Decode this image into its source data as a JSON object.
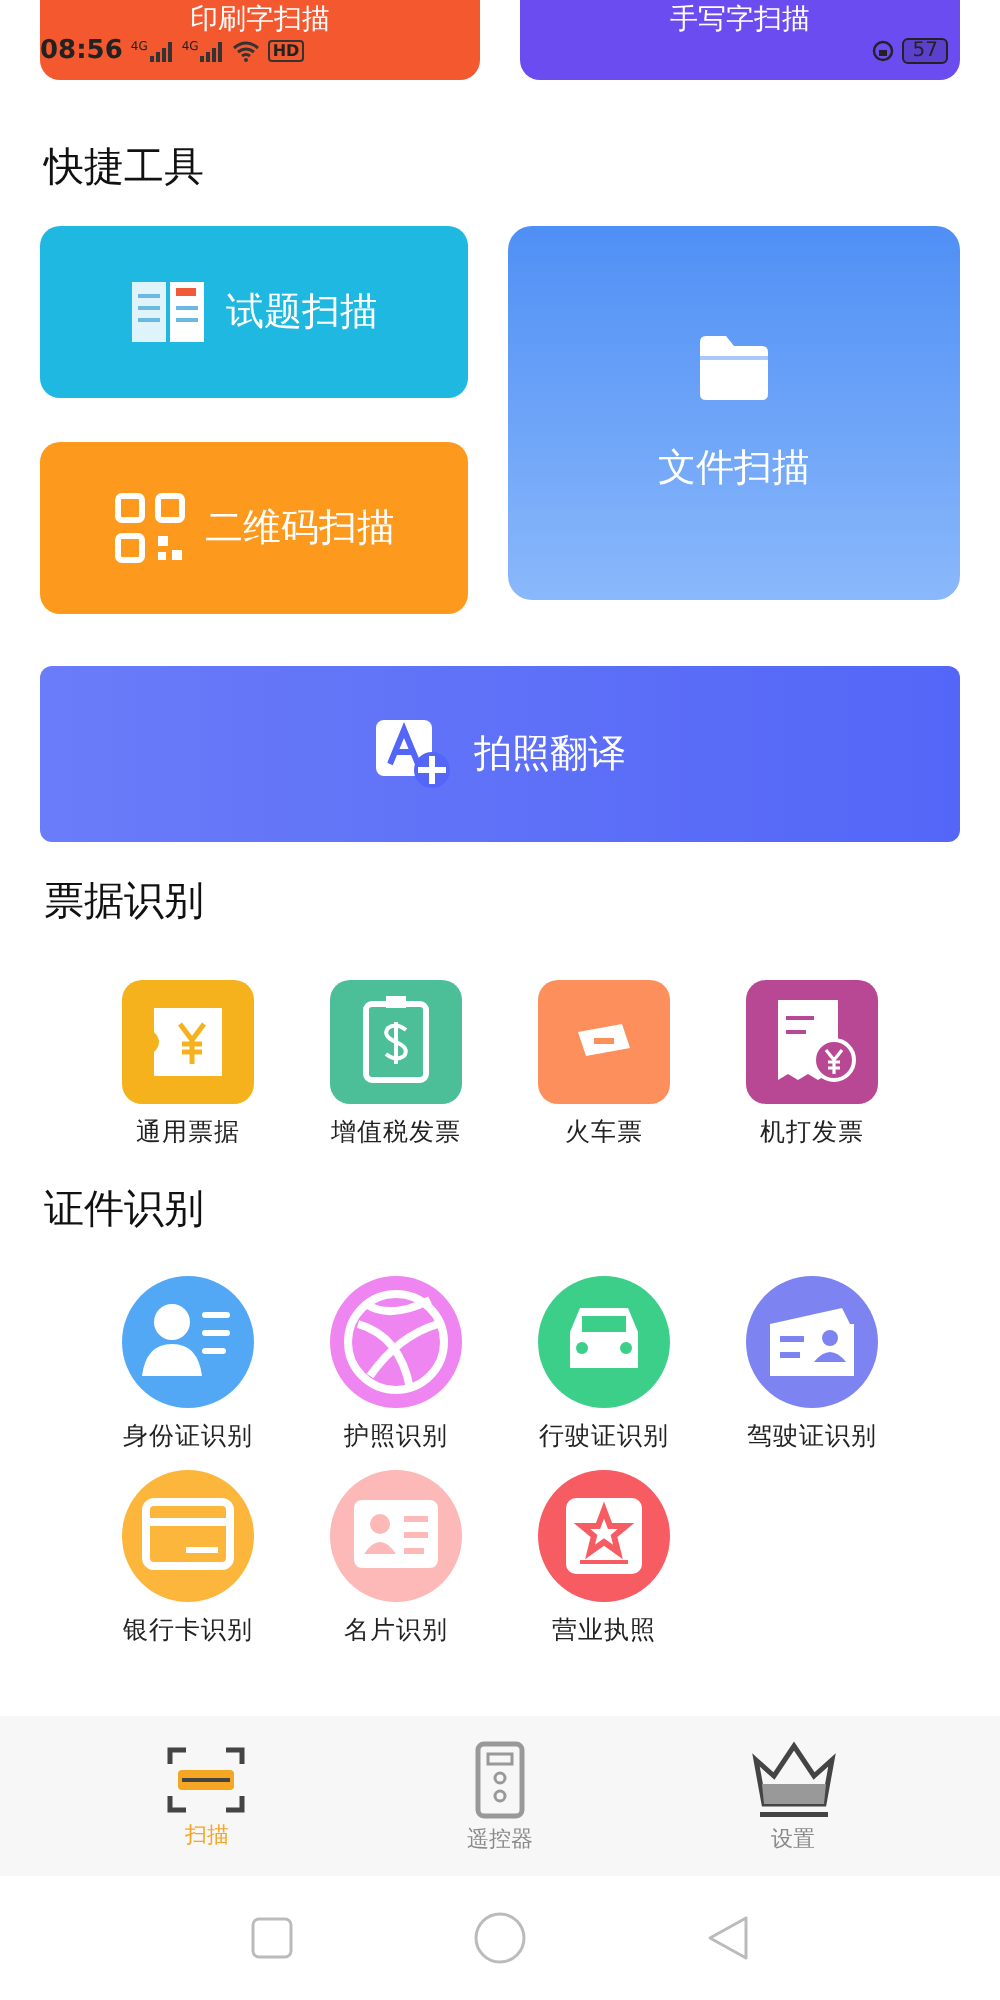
{
  "status_bar": {
    "time": "08:56",
    "networks": [
      "4G",
      "4G"
    ],
    "hd": "HD",
    "battery": "57"
  },
  "top_cards": [
    {
      "label": "印刷字扫描",
      "color": "#f4582f"
    },
    {
      "label": "手写字扫描",
      "color": "#6a4cf0"
    }
  ],
  "quick_tools": {
    "title": "快捷工具",
    "items": [
      {
        "label": "试题扫描",
        "kind": "small",
        "color": "#1fb8e0"
      },
      {
        "label": "二维码扫描",
        "kind": "small",
        "color": "#fd9a1e"
      },
      {
        "label": "文件扫描",
        "kind": "tall",
        "color": "#4f8ff5"
      },
      {
        "label": "拍照翻译",
        "kind": "wide",
        "color": "#5366f7"
      }
    ]
  },
  "receipts": {
    "title": "票据识别",
    "items": [
      {
        "label": "通用票据",
        "color": "#f5b21c"
      },
      {
        "label": "增值税发票",
        "color": "#4cbf99"
      },
      {
        "label": "火车票",
        "color": "#fd8f5c"
      },
      {
        "label": "机打发票",
        "color": "#b94894"
      }
    ]
  },
  "certificates": {
    "title": "证件识别",
    "items": [
      {
        "label": "身份证识别",
        "color": "#52a8f5"
      },
      {
        "label": "护照识别",
        "color": "#ee85f0"
      },
      {
        "label": "行驶证识别",
        "color": "#3ccf8a"
      },
      {
        "label": "驾驶证识别",
        "color": "#7d84f2"
      },
      {
        "label": "银行卡识别",
        "color": "#fdb63c"
      },
      {
        "label": "名片识别",
        "color": "#fdb8b8"
      },
      {
        "label": "营业执照",
        "color": "#f75c62"
      }
    ]
  },
  "bottom_nav": [
    {
      "label": "扫描",
      "selected": true
    },
    {
      "label": "遥控器",
      "selected": false
    },
    {
      "label": "设置",
      "selected": false
    }
  ]
}
